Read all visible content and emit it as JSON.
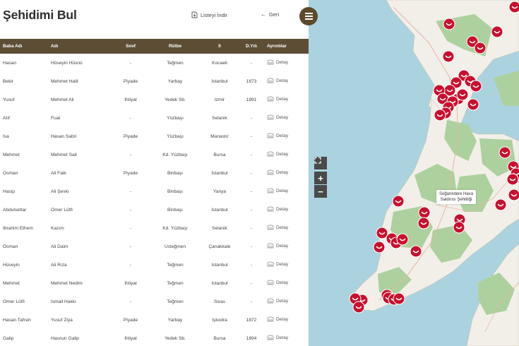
{
  "header": {
    "title": "Şehidimi Bul",
    "download_label": "Listeyi İndir",
    "back_label": "Geri"
  },
  "table": {
    "columns": [
      "Baba Adı",
      "Adı",
      "Sınıf",
      "Rütbe",
      "İl",
      "D.Yılı",
      "Ayrıntılar"
    ],
    "detail_label": "Detay",
    "rows": [
      [
        "Hasan",
        "Hüseyin Hüsnü",
        "-",
        "Teğmen",
        "Kocaeli",
        "-"
      ],
      [
        "Bekir",
        "Mehmet Halit",
        "Piyade",
        "Yarbay",
        "İstanbul",
        "1873"
      ],
      [
        "Yusuf",
        "Mehmet Ali",
        "İhtiyat",
        "Yedek Sb.",
        "İzmir",
        "1891"
      ],
      [
        "Atıf",
        "Fuat",
        "-",
        "Yüzbaşı",
        "Selanik",
        "-"
      ],
      [
        "İsa",
        "Hasan Sabri",
        "Piyade",
        "Yüzbaşı",
        "Manastır",
        "-"
      ],
      [
        "Mehmet",
        "Mehmet Sait",
        "-",
        "Kd. Yüzbaşı",
        "Bursa",
        "-"
      ],
      [
        "Osman",
        "Ali Faik",
        "Piyade",
        "Binbaşı",
        "İstanbul",
        "-"
      ],
      [
        "Hasip",
        "Ali Şevki",
        "-",
        "Binbaşı",
        "Yanya",
        "-"
      ],
      [
        "Abdulsettar",
        "Ömer Lütfi",
        "-",
        "Binbaşı",
        "İstanbul",
        "-"
      ],
      [
        "İbrahim Ethem",
        "Kazım",
        "-",
        "Kd. Yüzbaşı",
        "Selanik",
        "-"
      ],
      [
        "Osman",
        "Ali Daim",
        "-",
        "Üsteğmen",
        "Çanakkale",
        "-"
      ],
      [
        "Hüseyin",
        "Ali Rıza",
        "-",
        "Teğmen",
        "İstanbul",
        "-"
      ],
      [
        "Mehmet",
        "Mehmet Nedim",
        "İhtiyat",
        "Teğmen",
        "İstanbul",
        "-"
      ],
      [
        "Ömer Lütfi",
        "İsmail Hakkı",
        "-",
        "Teğmen",
        "Sivas",
        "-"
      ],
      [
        "Hasan Tahsin",
        "Yusuf Ziya",
        "Piyade",
        "Yarbay",
        "İşkodra",
        "1872"
      ],
      [
        "Galip",
        "Hasnun Galip",
        "İhtiyat",
        "Yedek Sb.",
        "Bursa",
        "1894"
      ]
    ]
  },
  "map": {
    "tooltip_line1": "Soğanlıdere Hava",
    "tooltip_line2": "Saldırısı Şehitliği",
    "zoom_in_label": "+",
    "zoom_out_label": "−",
    "land_color": "#f2efe9",
    "forest_color": "#add19e",
    "water_color": "#aad3df",
    "marker_color": "#c8102e"
  }
}
